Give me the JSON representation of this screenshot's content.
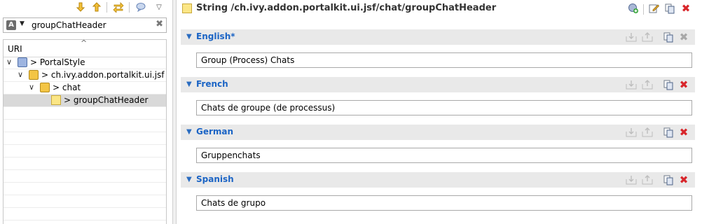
{
  "left": {
    "toolbar_icons": [
      "arrow-down-icon",
      "arrow-up-icon",
      "swap-arrows-icon",
      "comment-icon",
      "view-menu-icon"
    ],
    "filter": {
      "badge": "A",
      "value": "groupChatHeader",
      "placeholder": ""
    },
    "tree_header": "URI",
    "tree": [
      {
        "label": "> PortalStyle",
        "icon": "project",
        "level": 0
      },
      {
        "label": "> ch.ivy.addon.portalkit.ui.jsf",
        "icon": "folder",
        "level": 1
      },
      {
        "label": "> chat",
        "icon": "folder",
        "level": 2
      },
      {
        "label": "> groupChatHeader",
        "icon": "string",
        "level": 3,
        "selected": true
      }
    ]
  },
  "right": {
    "title": "String /ch.ivy.addon.portalkit.ui.jsf/chat/groupChatHeader",
    "header_icons": [
      "add-language-icon",
      "edit-icon",
      "copy-icon",
      "delete-icon"
    ],
    "languages": [
      {
        "name": "English*",
        "value": "Group (Process) Chats",
        "delete_enabled": false
      },
      {
        "name": "French",
        "value": "Chats de groupe (de processus)",
        "delete_enabled": true
      },
      {
        "name": "German",
        "value": "Gruppenchats",
        "delete_enabled": true
      },
      {
        "name": "Spanish",
        "value": "Chats de grupo",
        "delete_enabled": true
      }
    ]
  },
  "colors": {
    "accent": "#1b64c5",
    "delete": "#d8262b",
    "section_bg": "#e9e9e9"
  }
}
